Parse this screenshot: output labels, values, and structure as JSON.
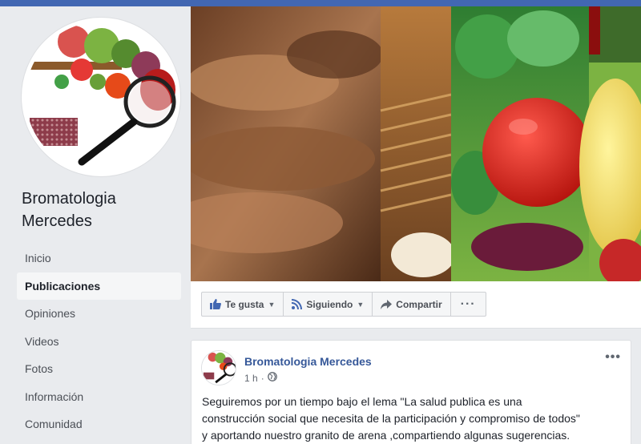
{
  "page": {
    "name_line1": "Bromatologia",
    "name_line2": "Mercedes"
  },
  "nav": {
    "items": [
      {
        "label": "Inicio"
      },
      {
        "label": "Publicaciones"
      },
      {
        "label": "Opiniones"
      },
      {
        "label": "Videos"
      },
      {
        "label": "Fotos"
      },
      {
        "label": "Información"
      },
      {
        "label": "Comunidad"
      }
    ],
    "active": "Publicaciones"
  },
  "actions": {
    "like_label": "Te gusta",
    "follow_label": "Siguiendo",
    "share_label": "Compartir",
    "more_label": "···"
  },
  "post": {
    "author": "Bromatologia Mercedes",
    "time": "1 h",
    "separator": "·",
    "menu_label": "•••",
    "text_lines": [
      "Seguiremos por un tiempo bajo el lema \"La salud publica es una",
      "construcción social que necesita de la participación y compromiso de todos\"",
      "y aportando nuestro granito de arena ,compartiendo algunas sugerencias."
    ]
  },
  "colors": {
    "brand": "#4267b2",
    "link": "#365899",
    "background": "#e9ebee"
  },
  "icons": {
    "like": "thumbs-up-icon",
    "follow": "rss-icon",
    "share": "share-arrow-icon",
    "privacy": "globe-icon"
  }
}
